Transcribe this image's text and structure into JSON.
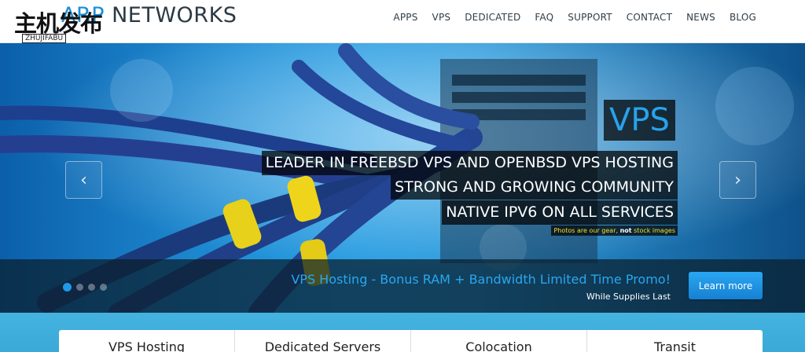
{
  "header": {
    "brand_prefix": "ARP",
    "brand_name": "NETWORKS",
    "watermark_cn": "主机发布",
    "watermark_latin": "ZHUJIFABU",
    "nav": [
      "APPS",
      "VPS",
      "DEDICATED",
      "FAQ",
      "SUPPORT",
      "CONTACT",
      "NEWS",
      "BLOG"
    ]
  },
  "hero": {
    "prev_arrow": "‹",
    "next_arrow": "›",
    "title": "VPS",
    "lines": [
      "LEADER IN FREEBSD VPS AND OPENBSD VPS HOSTING",
      "STRONG AND GROWING COMMUNITY",
      "NATIVE IPV6 ON ALL SERVICES"
    ],
    "note_pre": "Photos are our gear, ",
    "note_bold": "not",
    "note_post": " stock images"
  },
  "promo": {
    "dots_total": 4,
    "dots_active": 1,
    "title": "VPS Hosting - Bonus RAM + Bandwidth Limited Time Promo!",
    "subtitle": "While Supplies Last",
    "button": "Learn more"
  },
  "tabs": [
    "VPS Hosting",
    "Dedicated Servers",
    "Colocation",
    "Transit"
  ],
  "colors": {
    "accent": "#1e9ae8",
    "brand_dark": "#2b3a44",
    "caption_title": "#27a3ec",
    "note_yellow": "#f4e12a"
  }
}
